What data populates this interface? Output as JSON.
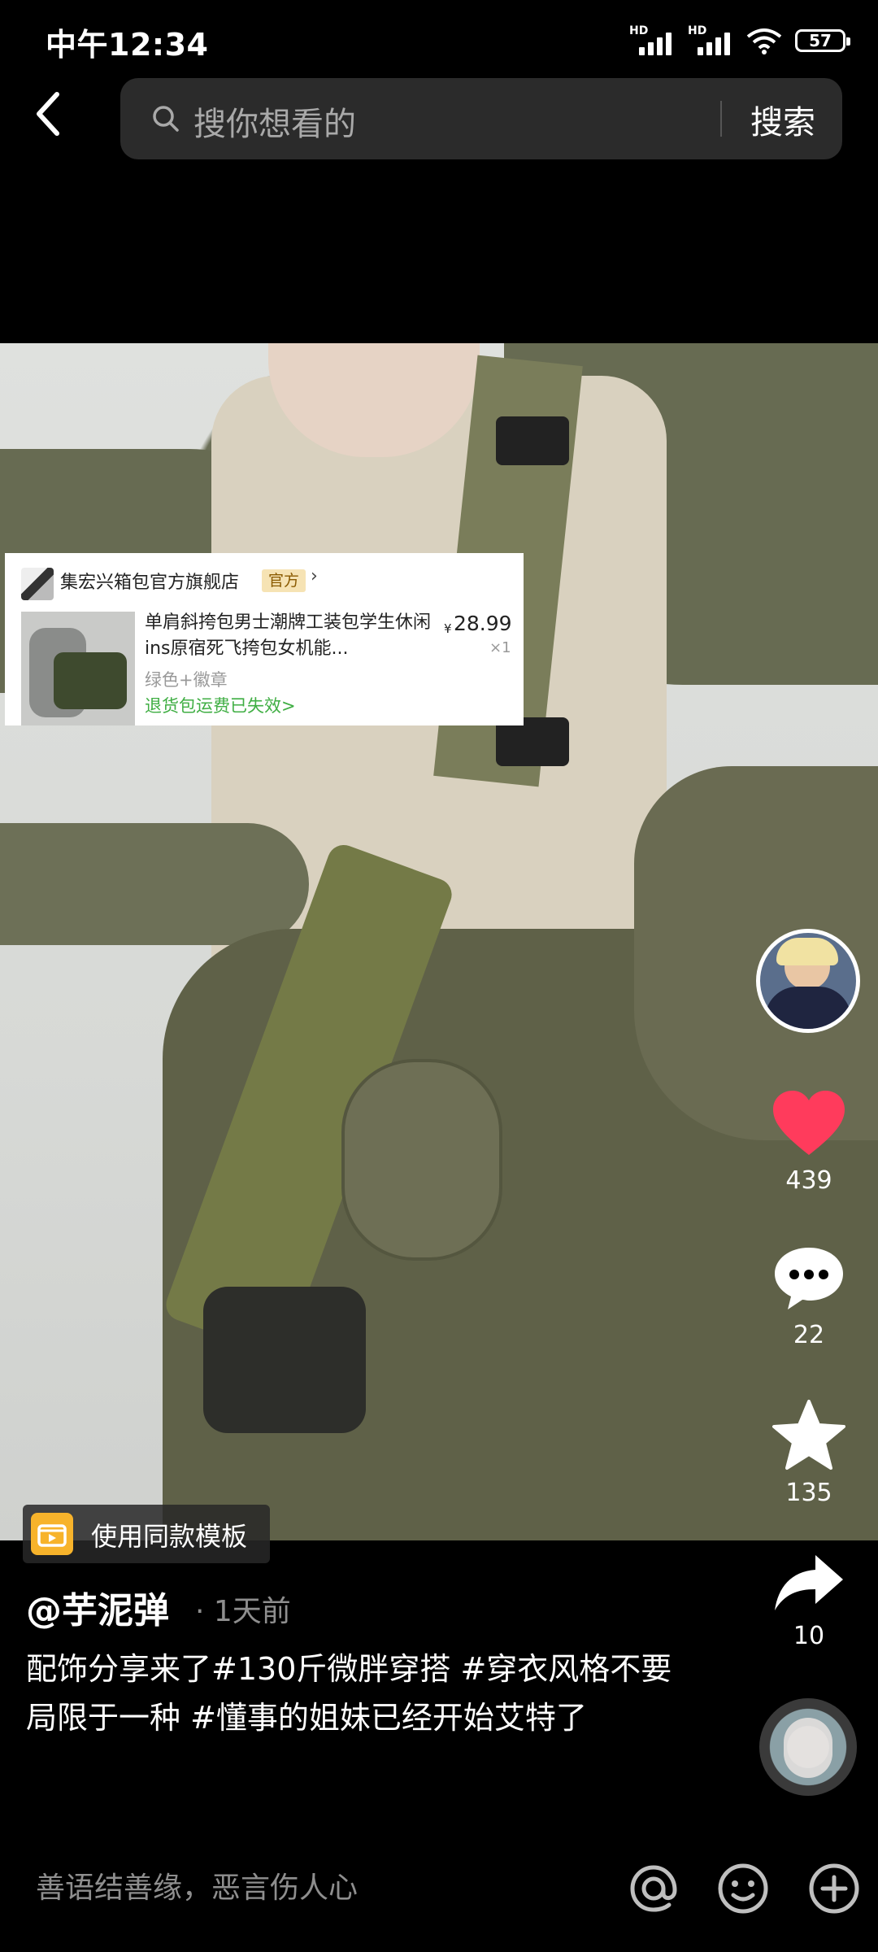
{
  "status_bar": {
    "time": "中午12:34",
    "hd_1": "HD",
    "hd_2": "HD",
    "battery": "57"
  },
  "search": {
    "placeholder": "搜你想看的",
    "submit_label": "搜索"
  },
  "product_card": {
    "shop_name": "集宏兴箱包官方旗舰店",
    "official_badge": "官方",
    "title": "单肩斜挎包男士潮牌工装包学生休闲ins原宿死飞挎包女机能...",
    "price_symbol": "¥",
    "price": "28.99",
    "quantity": "×1",
    "spec": "绿色+徽章",
    "notice": "退货包运费已失效>"
  },
  "rail": {
    "likes": "439",
    "comments": "22",
    "favorites": "135",
    "shares": "10"
  },
  "template_button": {
    "label": "使用同款模板"
  },
  "post": {
    "author": "@芋泥弹",
    "time_ago": "· 1天前",
    "caption": "配饰分享来了#130斤微胖穿搭 #穿衣风格不要局限于一种 #懂事的姐妹已经开始艾特了"
  },
  "comment_bar": {
    "placeholder": "善语结善缘，恶言伤人心"
  },
  "icons": {
    "back": "chevron-left-icon",
    "search": "search-icon",
    "like": "heart-icon",
    "comment": "speech-bubble-icon",
    "favorite": "star-icon",
    "share": "share-arrow-icon",
    "mention": "at-icon",
    "emoji": "smiley-icon",
    "add": "plus-circle-icon"
  },
  "colors": {
    "like_heart": "#ff3b5c",
    "notice_green": "#3fae43",
    "badge_bg": "#f6e3b4",
    "template_icon": "#f7b32b"
  }
}
